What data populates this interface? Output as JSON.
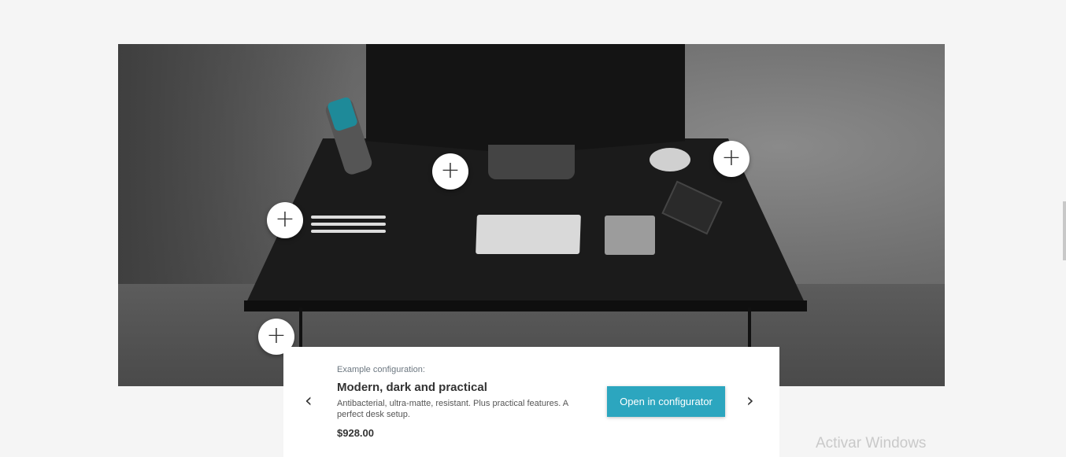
{
  "hero": {
    "hotspots": [
      "+",
      "+",
      "+",
      "+"
    ]
  },
  "card": {
    "eyebrow": "Example configuration:",
    "title": "Modern, dark and practical",
    "description": "Antibacterial, ultra-matte, resistant. Plus practical features. A perfect desk setup.",
    "price": "$928.00",
    "cta_label": "Open in configurator",
    "prev_icon": "‹",
    "next_icon": "›"
  },
  "watermark": "Activar Windows",
  "colors": {
    "accent": "#2ca6bf",
    "background": "#f5f5f5"
  },
  "icons": {
    "hotspot": "plus-icon",
    "prev": "chevron-left-icon",
    "next": "chevron-right-icon"
  }
}
